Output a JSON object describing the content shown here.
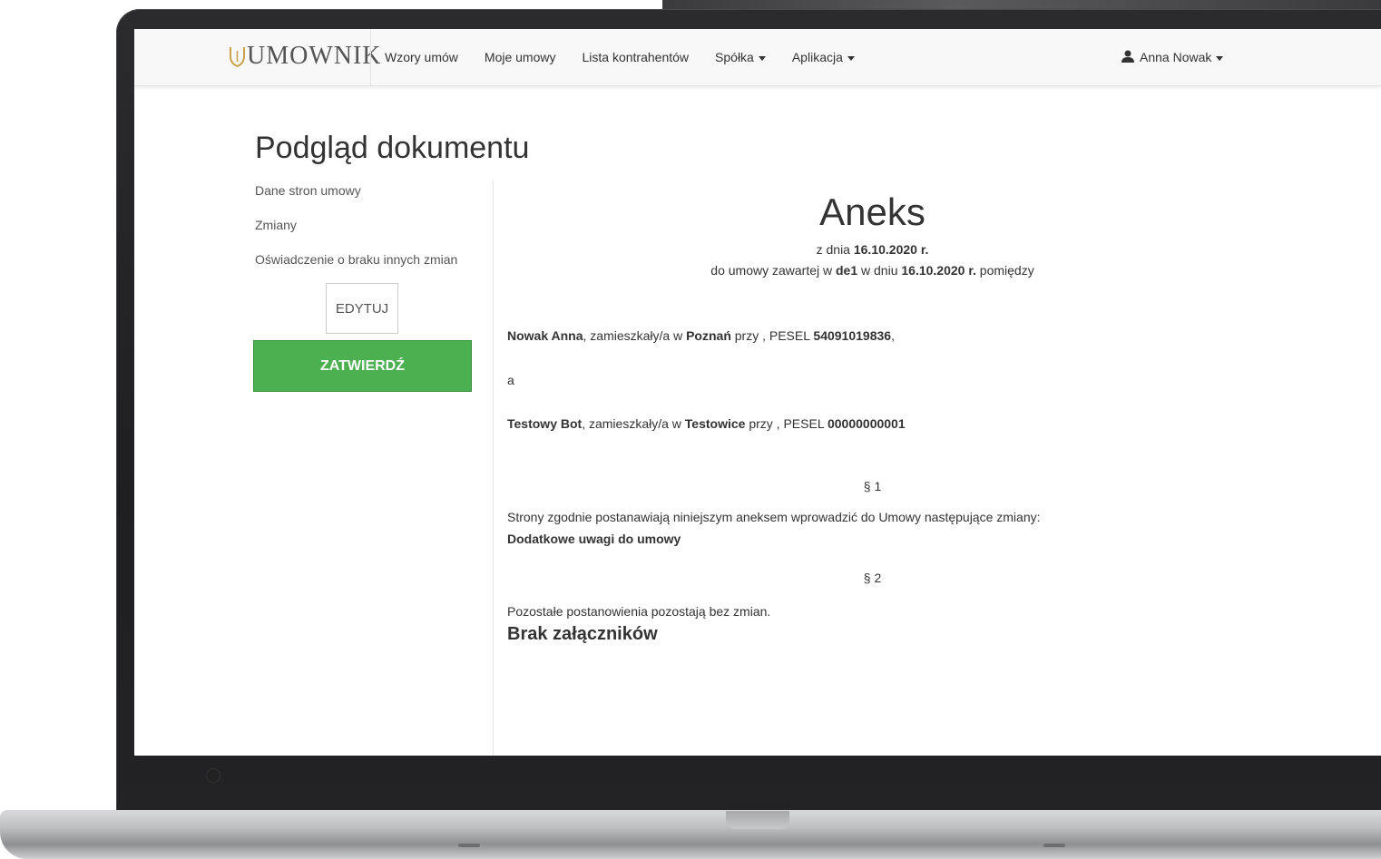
{
  "nav": {
    "logo": "UMOWNIK",
    "items": [
      {
        "label": "Wzory umów",
        "dropdown": false
      },
      {
        "label": "Moje umowy",
        "dropdown": false
      },
      {
        "label": "Lista kontrahentów",
        "dropdown": false
      },
      {
        "label": "Spółka",
        "dropdown": true
      },
      {
        "label": "Aplikacja",
        "dropdown": true
      }
    ],
    "user": "Anna Nowak"
  },
  "page": {
    "title": "Podgląd dokumentu"
  },
  "sidebar": {
    "links": [
      "Dane stron umowy",
      "Zmiany",
      "Oświadczenie o braku innych zmian"
    ],
    "edit_label": "EDYTUJ",
    "confirm_label": "ZATWIERDŹ"
  },
  "document": {
    "title": "Aneks",
    "date_prefix": "z dnia",
    "date": "16.10.2020 r.",
    "contract_prefix": "do umowy zawartej w",
    "contract_place": "de1",
    "contract_mid": "w dniu",
    "contract_date": "16.10.2020 r.",
    "contract_suffix": "pomiędzy",
    "party1": {
      "name": "Nowak Anna",
      "mid": ", zamieszkały/a w",
      "city": "Poznań",
      "pesel_prefix": "przy , PESEL",
      "pesel": "54091019836",
      "end": ","
    },
    "and": "a",
    "party2": {
      "name": "Testowy Bot",
      "mid": ", zamieszkały/a w",
      "city": "Testowice",
      "pesel_prefix": "przy , PESEL",
      "pesel": "00000000001"
    },
    "section1_mark": "§ 1",
    "section1_text": "Strony zgodnie postanawiają niniejszym aneksem wprowadzić do Umowy następujące zmiany:",
    "section1_change": "Dodatkowe uwagi do umowy",
    "section2_mark": "§ 2",
    "section2_text": "Pozostałe postanowienia pozostają bez zmian.",
    "attachments": "Brak załączników"
  },
  "colors": {
    "confirm_green": "#4caf50",
    "logo_gold": "#c9a24a",
    "navbar_bg": "#f8f8f8"
  }
}
